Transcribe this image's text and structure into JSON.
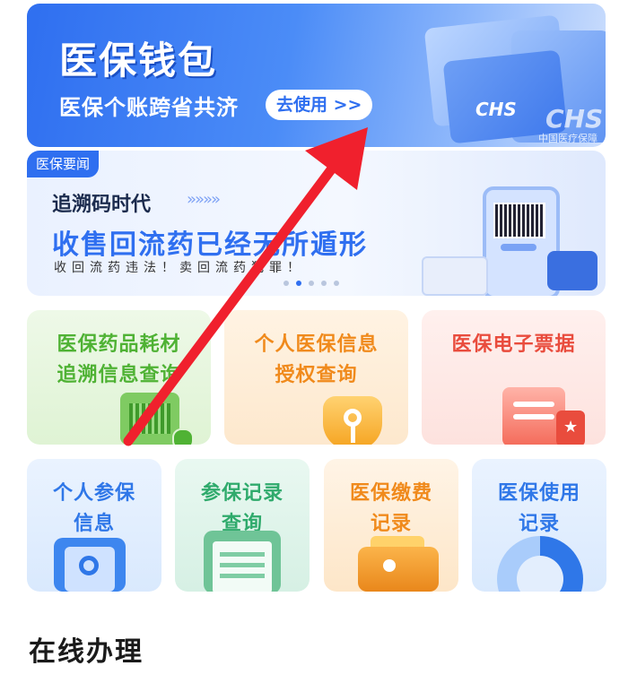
{
  "wallet": {
    "title": "医保钱包",
    "subtitle": "医保个账跨省共济",
    "button": "去使用 >>",
    "card_brand": "CHS",
    "card_brand_sub": "中国医疗保障"
  },
  "news": {
    "tag": "医保要闻",
    "headline": "追溯码时代",
    "arrows": "»»»»",
    "main": "收售回流药已经无所遁形",
    "slogan": "收回流药违法！卖回流药犯罪！",
    "active_dot": 1,
    "dot_count": 5
  },
  "services_row1": [
    {
      "label": "医保药品耗材\n追溯信息查询",
      "icon": "barcode-scan-icon"
    },
    {
      "label": "个人医保信息\n授权查询",
      "icon": "key-shield-icon"
    },
    {
      "label": "医保电子票据",
      "icon": "receipt-icon"
    }
  ],
  "services_row2": [
    {
      "label": "个人参保\n信息",
      "icon": "person-search-icon"
    },
    {
      "label": "参保记录\n查询",
      "icon": "clipboard-icon"
    },
    {
      "label": "医保缴费\n记录",
      "icon": "wallet-icon"
    },
    {
      "label": "医保使用\n记录",
      "icon": "donut-chart-icon"
    }
  ],
  "section": {
    "title": "在线办理"
  },
  "colors": {
    "brand_blue": "#2f6ff0",
    "annotation_arrow": "#f0202d"
  }
}
